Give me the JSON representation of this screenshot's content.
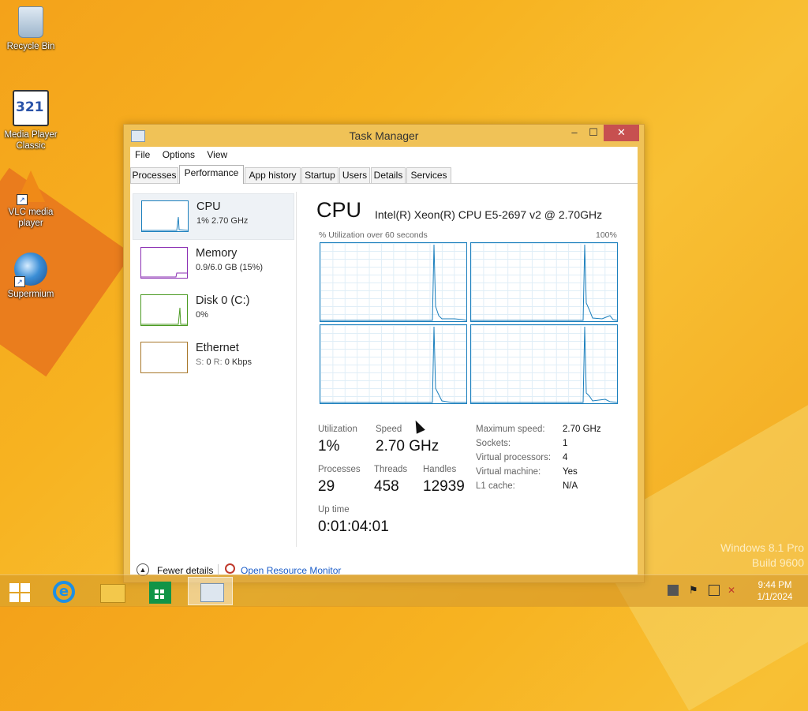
{
  "desktop": {
    "icons": [
      {
        "label": "Recycle Bin"
      },
      {
        "label": "Media Player Classic"
      },
      {
        "label": "VLC media player"
      },
      {
        "label": "Supermium"
      }
    ],
    "watermark": {
      "line1": "Windows 8.1 Pro",
      "line2": "Build 9600"
    }
  },
  "window": {
    "title": "Task Manager",
    "minimize_glyph": "–",
    "maximize_glyph": "☐",
    "close_glyph": "✕",
    "menu": [
      "File",
      "Options",
      "View"
    ],
    "tabs": [
      "Processes",
      "Performance",
      "App history",
      "Startup",
      "Users",
      "Details",
      "Services"
    ],
    "active_tab": "Performance"
  },
  "sidebar": {
    "items": [
      {
        "name": "CPU",
        "value": "1% 2.70 GHz",
        "color": "#1b7fbd"
      },
      {
        "name": "Memory",
        "value": "0.9/6.0 GB (15%)",
        "color": "#8b2fb3"
      },
      {
        "name": "Disk 0 (C:)",
        "value": "0%",
        "color": "#4b9a22"
      },
      {
        "name": "Ethernet",
        "value_prefix": "S:",
        "value_mid": "0",
        "value_r": "R:",
        "value_rest": "0 Kbps",
        "color": "#a8772a"
      }
    ]
  },
  "cpu_panel": {
    "title": "CPU",
    "model": "Intel(R) Xeon(R) CPU E5-2697 v2 @ 2.70GHz",
    "graph_label": "% Utilization over 60 seconds",
    "graph_max": "100%",
    "graph_color": "#1b7fbd",
    "stats": {
      "utilization_label": "Utilization",
      "utilization": "1%",
      "speed_label": "Speed",
      "speed": "2.70 GHz",
      "processes_label": "Processes",
      "processes": "29",
      "threads_label": "Threads",
      "threads": "458",
      "handles_label": "Handles",
      "handles": "12939",
      "uptime_label": "Up time",
      "uptime": "0:01:04:01"
    },
    "details": [
      {
        "label": "Maximum speed:",
        "value": "2.70 GHz"
      },
      {
        "label": "Sockets:",
        "value": "1"
      },
      {
        "label": "Virtual processors:",
        "value": "4"
      },
      {
        "label": "Virtual machine:",
        "value": "Yes"
      },
      {
        "label": "L1 cache:",
        "value": "N/A"
      }
    ]
  },
  "footer": {
    "fewer_details": "Fewer details",
    "open_resource_monitor": "Open Resource Monitor"
  },
  "taskbar": {
    "time": "9:44 PM",
    "date": "1/1/2024"
  }
}
